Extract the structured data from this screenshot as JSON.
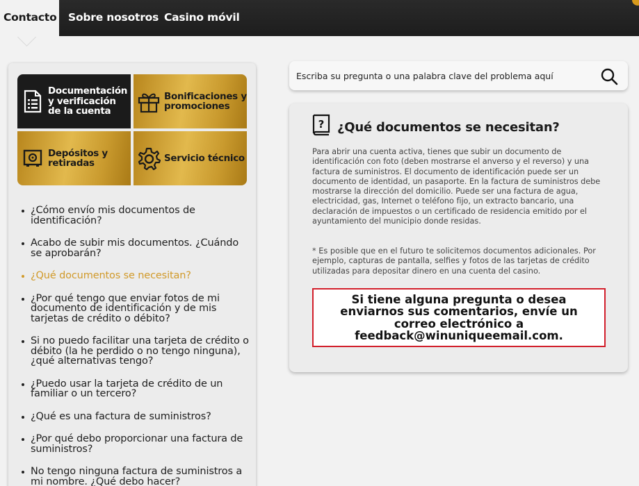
{
  "nav": {
    "tabs": [
      {
        "label": "Contacto",
        "active": true
      },
      {
        "label": "Sobre nosotros",
        "active": false
      },
      {
        "label": "Casino móvil",
        "active": false
      }
    ]
  },
  "categories": [
    {
      "label": "Documentación y verificación de la cuenta",
      "icon": "document-list-icon",
      "style": "dark"
    },
    {
      "label": "Bonificaciones y promociones",
      "icon": "gift-icon",
      "style": "gold"
    },
    {
      "label": "Depósitos y retiradas",
      "icon": "safe-icon",
      "style": "gold"
    },
    {
      "label": "Servicio técnico",
      "icon": "gear-icon",
      "style": "gold"
    }
  ],
  "questions": [
    {
      "text": "¿Cómo envío mis documentos de identificación?",
      "active": false
    },
    {
      "text": "Acabo de subir mis documentos. ¿Cuándo se aprobarán?",
      "active": false
    },
    {
      "text": "¿Qué documentos se necesitan?",
      "active": true
    },
    {
      "text": "¿Por qué tengo que enviar fotos de mi documento de identificación y de mis tarjetas de crédito o débito?",
      "active": false
    },
    {
      "text": "Si no puedo facilitar una tarjeta de crédito o débito (la he perdido o no tengo ninguna), ¿qué alternativas tengo?",
      "active": false
    },
    {
      "text": "¿Puedo usar la tarjeta de crédito de un familiar o un tercero?",
      "active": false
    },
    {
      "text": "¿Qué es una factura de suministros?",
      "active": false
    },
    {
      "text": "¿Por qué debo proporcionar una factura de suministros?",
      "active": false
    },
    {
      "text": "No tengo ninguna factura de suministros a mi nombre. ¿Qué debo hacer?",
      "active": false
    }
  ],
  "search": {
    "placeholder": "Escriba su pregunta o una palabra clave del problema aquí"
  },
  "answer": {
    "title": "¿Qué documentos se necesitan?",
    "body": "Para abrir una cuenta activa, tienes que subir un documento de identificación con foto (deben mostrarse el anverso y el reverso) y una factura de suministros. El documento de identificación puede ser un documento de identidad, un pasaporte. En la factura de suministros debe mostrarse la dirección del domicilio. Puede ser una factura de agua, electricidad, gas, Internet o teléfono fijo, un extracto bancario, una declaración de impuestos o un certificado de residencia emitido por el ayuntamiento del municipio donde residas.",
    "note": "* Es posible que en el futuro te solicitemos documentos adicionales. Por ejemplo, capturas de pantalla, selfies y fotos de las tarjetas de crédito utilizadas para depositar dinero en una cuenta del casino.",
    "feedback": "Si tiene alguna pregunta o desea enviarnos sus comentarios, envíe un correo electrónico a feedback@winuniqueemail.com."
  },
  "colors": {
    "accent_gold": "#d19a2a",
    "nav_bg": "#1d1d1d",
    "feedback_border": "#d21e2b"
  }
}
